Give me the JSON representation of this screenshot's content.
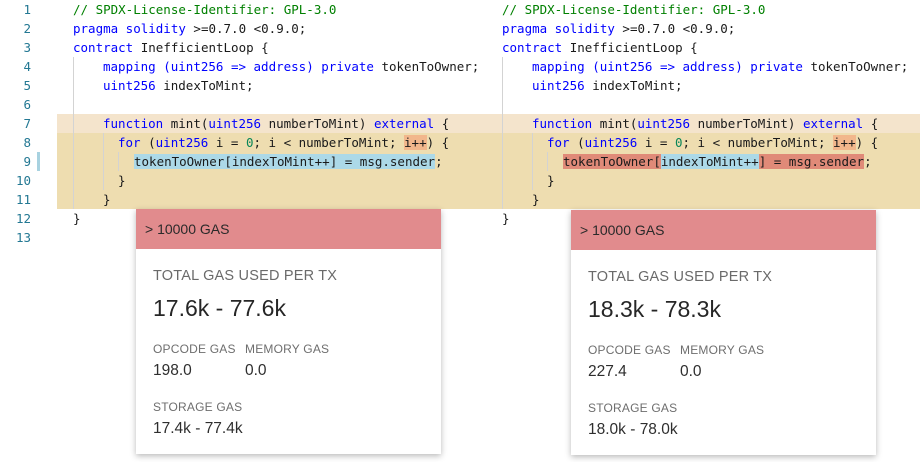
{
  "editor": {
    "line_numbers": [
      "1",
      "2",
      "3",
      "4",
      "5",
      "6",
      "7",
      "8",
      "9",
      "10",
      "11",
      "12",
      "13"
    ],
    "line1_comment": "// SPDX-License-Identifier: GPL-3.0",
    "line2_kw": "pragma solidity",
    "line2_rest": " >=0.7.0 <0.9.0;",
    "line3_kw": "contract",
    "line3_rest": " InefficientLoop {",
    "line4_kw": "mapping",
    "line4_type_open": " (uint256 => address) ",
    "line4_kw2": "private",
    "line4_rest": " tokenToOwner;",
    "line5_kw": "uint256",
    "line5_rest": " indexToMint;",
    "line7_kw": "function",
    "line7_mid": " mint(",
    "line7_kw2": "uint256",
    "line7_mid2": " numberToMint) ",
    "line7_kw3": "external",
    "line7_rest": " {",
    "line8_kw": "for",
    "line8_open": " (",
    "line8_kw2": "uint256",
    "line8_mid": " i = ",
    "line8_num": "0",
    "line8_mid2": "; i < numberToMint; ",
    "line8_inc": "i++",
    "line8_rest": ") {",
    "line9_a": "tokenToOwner",
    "line9_b": "[",
    "line9_c": "indexToMint++",
    "line9_d": "]",
    "line9_e": " = msg.sender",
    "line9_semi": ";",
    "line10": "}",
    "line11": "}",
    "line12": "}"
  },
  "cards": [
    {
      "header": "> 10000 GAS",
      "total_label": "TOTAL GAS USED PER TX",
      "total_value": "17.6k - 77.6k",
      "opcode_label": "OPCODE GAS",
      "opcode_value": "198.0",
      "memory_label": "MEMORY GAS",
      "memory_value": "0.0",
      "storage_label": "STORAGE GAS",
      "storage_value": "17.4k - 77.4k"
    },
    {
      "header": "> 10000 GAS",
      "total_label": "TOTAL GAS USED PER TX",
      "total_value": "18.3k - 78.3k",
      "opcode_label": "OPCODE GAS",
      "opcode_value": "227.4",
      "memory_label": "MEMORY GAS",
      "memory_value": "0.0",
      "storage_label": "STORAGE GAS",
      "storage_value": "18.0k - 78.0k"
    }
  ],
  "colors": {
    "function_block_highlight": "#f4e4cc",
    "loop_block_highlight": "#eeddb0",
    "card_header": "#e18b8d",
    "line_number": "#237893",
    "keyword": "#0000ff",
    "comment": "#008000"
  }
}
